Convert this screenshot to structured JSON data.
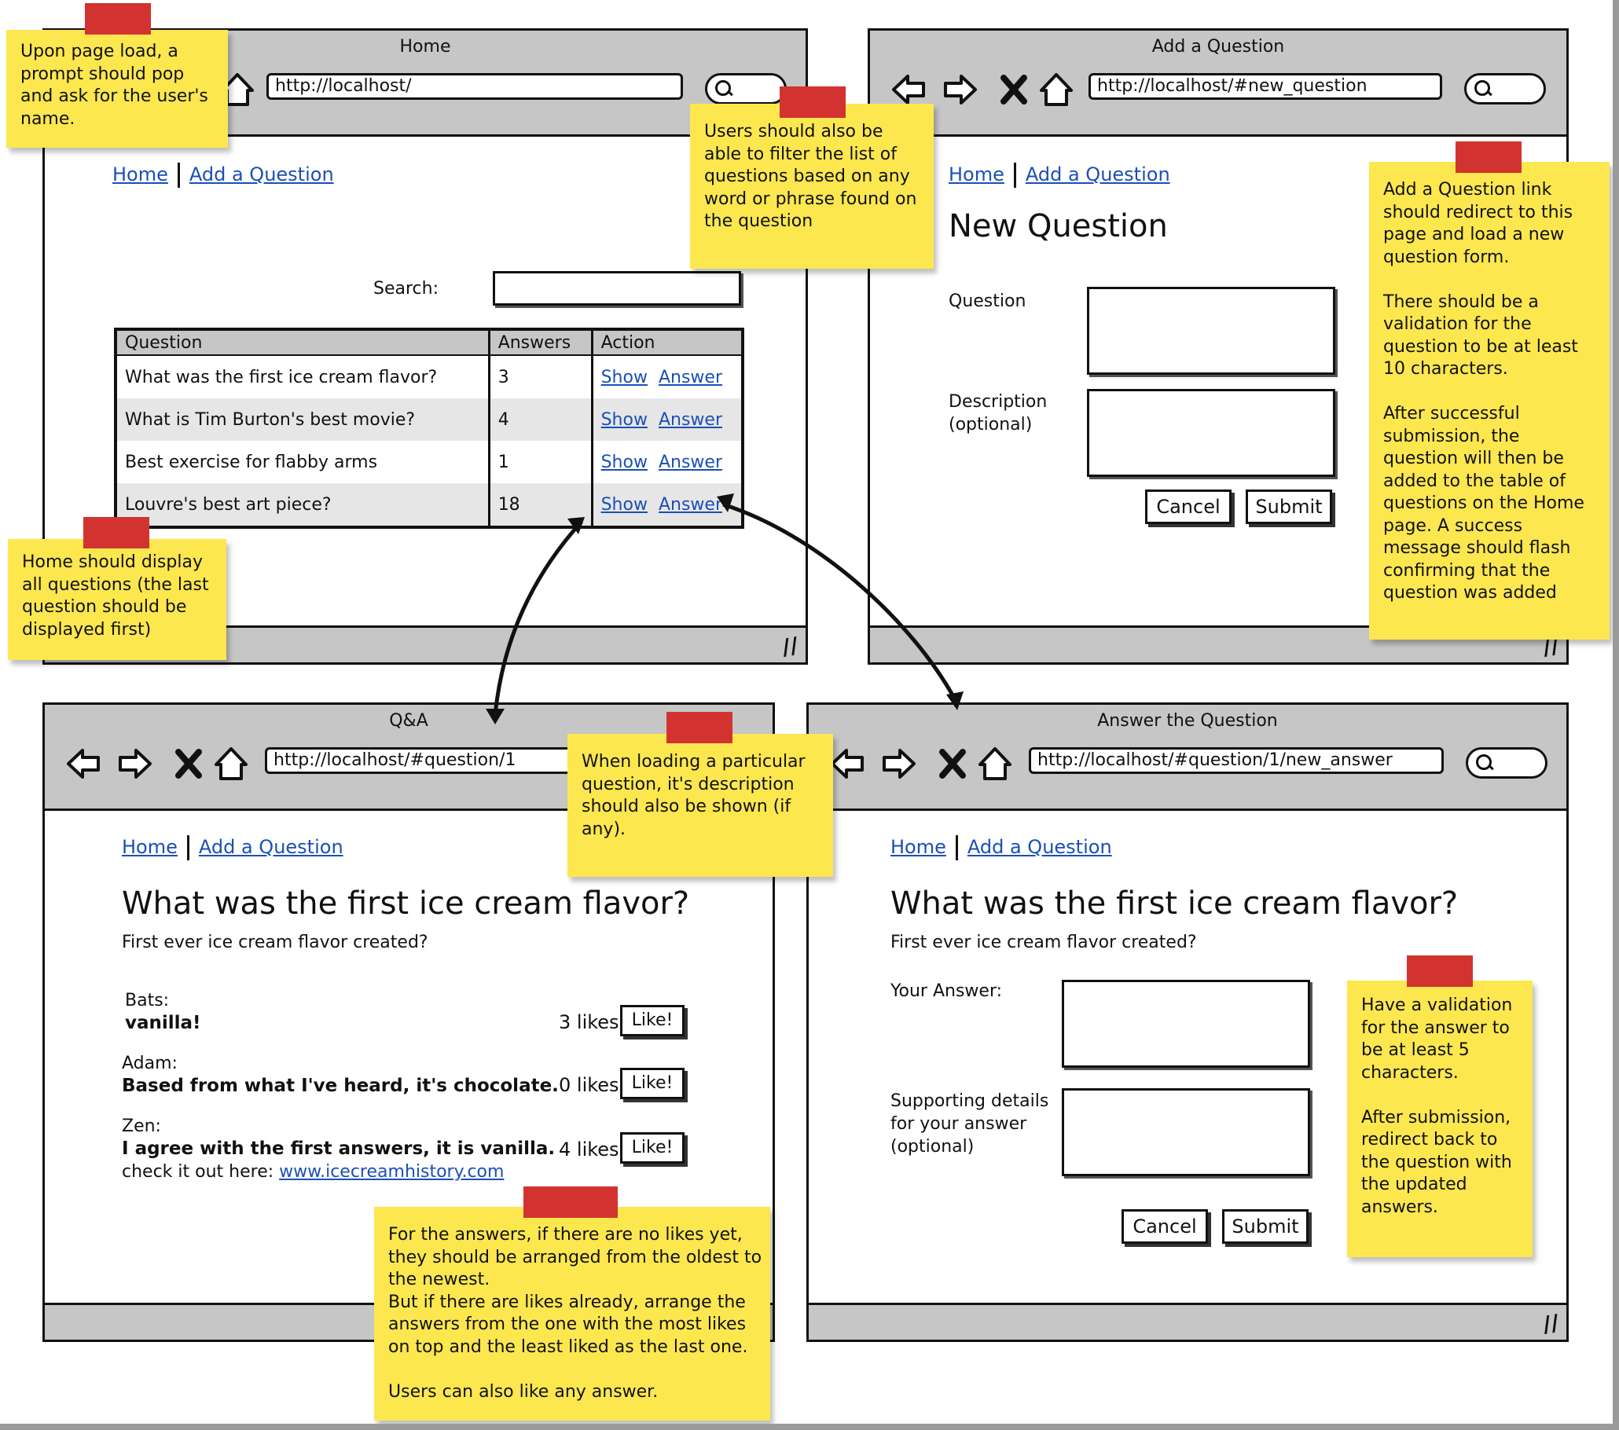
{
  "common": {
    "nav_home": "Home",
    "nav_add": "Add a Question",
    "btn_cancel": "Cancel",
    "btn_submit": "Submit"
  },
  "home_window": {
    "title": "Home",
    "url": "http://localhost/",
    "search_label": "Search:",
    "table": {
      "headers": [
        "Question",
        "Answers",
        "Action"
      ],
      "rows": [
        {
          "question": "What was the first ice cream flavor?",
          "answers": "3",
          "show": "Show",
          "answer": "Answer"
        },
        {
          "question": "What is Tim Burton's best movie?",
          "answers": "4",
          "show": "Show",
          "answer": "Answer"
        },
        {
          "question": "Best exercise for flabby arms",
          "answers": "1",
          "show": "Show",
          "answer": "Answer"
        },
        {
          "question": "Louvre's best art piece?",
          "answers": "18",
          "show": "Show",
          "answer": "Answer"
        }
      ]
    }
  },
  "add_window": {
    "title": "Add a Question",
    "url": "http://localhost/#new_question",
    "heading": "New Question",
    "question_label": "Question",
    "description_label": [
      "Description",
      "(optional)"
    ]
  },
  "qa_window": {
    "title": "Q&A",
    "url": "http://localhost/#question/1",
    "heading": "What was the first ice cream flavor?",
    "description": "First ever ice cream flavor created?",
    "answers": [
      {
        "author": "Bats:",
        "text": "vanilla!",
        "likes": "3 likes",
        "like_btn": "Like!"
      },
      {
        "author": "Adam:",
        "text": "Based from what I've heard, it's chocolate.",
        "likes": "0 likes",
        "like_btn": "Like!"
      },
      {
        "author": "Zen:",
        "text": "I agree with the first answers, it is vanilla.",
        "extra": "check it out here: ",
        "link": "www.icecreamhistory.com",
        "likes": "4 likes",
        "like_btn": "Like!"
      }
    ]
  },
  "answer_window": {
    "title": "Answer the Question",
    "url": "http://localhost/#question/1/new_answer",
    "heading": "What was the first ice cream flavor?",
    "description": "First ever ice cream flavor created?",
    "your_answer_label": "Your Answer:",
    "details_label": [
      "Supporting details",
      "for your answer",
      "(optional)"
    ]
  },
  "notes": {
    "page_load": [
      "Upon page load, a",
      "prompt should pop",
      "and ask for the user's",
      "name."
    ],
    "filter": [
      "Users should also be",
      "able to filter the list of",
      "questions based on any",
      "word or phrase found on",
      "the question"
    ],
    "add_question": [
      "Add a Question link",
      "should redirect to this",
      "page and load a new",
      "question form.",
      "",
      "There should be a",
      "validation for the",
      "question to be at least",
      "10 characters.",
      "",
      "After successful",
      "submission, the",
      "question will then be",
      "added to the table of",
      "questions on the Home",
      "page. A success",
      "message should flash",
      "confirming that the",
      "question was added"
    ],
    "home_display": [
      "Home should display",
      "all questions (the last",
      "question should be",
      "displayed first)"
    ],
    "description": [
      "When loading a particular",
      "question, it's description",
      "should also be shown (if",
      "any)."
    ],
    "answers_order": [
      "For the answers, if there are no likes yet,",
      "they should be arranged from the oldest to",
      "the newest.",
      "But if there are likes already, arrange the",
      "answers from the one with the most likes",
      "on top and the least liked as the last one.",
      "",
      "Users can also like any answer."
    ],
    "answer_validation": [
      "Have a validation",
      "for the answer to",
      "be at least 5",
      "characters.",
      "",
      "After submission,",
      "redirect back to",
      "the question with",
      "the updated",
      "answers."
    ]
  }
}
